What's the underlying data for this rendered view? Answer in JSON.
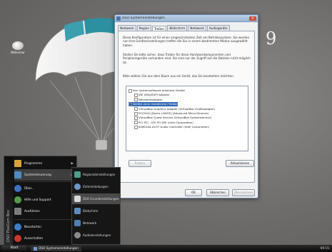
{
  "desktop": {
    "icon_label": "Mülleimer",
    "brand_numeral": "9"
  },
  "dialog": {
    "title": "DSO Systemeinstellungen",
    "tabs": [
      "Netzwerk",
      "Region",
      "Treiber",
      "Bildschirm",
      "Netzwerk",
      "Audiogeräte"
    ],
    "active_tab_index": 2,
    "intro_text": "Diese Konfiguration ist für einen eingeschränkten Zeit am Betriebssystem. Sie werden nun Ihre Geräteeinstellungen treffen die Sie in einem bestimmten Modus ausgewählt haben.",
    "hint_text": "Stellen Sie bitte sicher, dass Treiber für diese Hardwarekomponenten und Peripheriegeräte vorhanden sind. Sie sind nur der Zugriff auf die Dateien nicht möglich ist.",
    "list_caption": "Bitte wählen Sie aus dem Baum aus ein Gerät, das Sie bearbeiten möchten.",
    "tree": [
      {
        "label": "Von Systemsoftware erkannte Geräte",
        "indent": 0,
        "sel": false
      },
      {
        "label": "IDE ATA/ATAPI Adapter",
        "indent": 1,
        "sel": false
      },
      {
        "label": "Netzwerkadapter",
        "indent": 1,
        "sel": false
      },
      {
        "label": "Geräte ohne installierten Treiber",
        "indent": 0,
        "sel": true
      },
      {
        "label": "VirtualBox Graphics Adapter (VirtualBox Grafikadapter)",
        "indent": 1,
        "sel": false
      },
      {
        "label": "PCI/VGA [Dachs LANCE] (Advanced Micro Devices)",
        "indent": 1,
        "sel": false
      },
      {
        "label": "VirtualBox Guest Service (VirtualBox Systemservice)",
        "indent": 1,
        "sel": false
      },
      {
        "label": "PCI PCI - ICH PCI IDE (Intel Corporation)",
        "indent": 1,
        "sel": false
      },
      {
        "label": "82801AA AC97 Audio Controller (Intel Corporation)",
        "indent": 1,
        "sel": false
      }
    ],
    "btn_left": "Ändern",
    "btn_refresh": "Aktualisieren",
    "btn_ok": "OK",
    "btn_cancel": "Abbrechen",
    "btn_apply": "Übernehmen"
  },
  "start_menu": {
    "brand": "DSO PlusCom Box",
    "items": [
      {
        "label": "Programme",
        "arrow": true
      },
      {
        "label": "Systemsteuerung",
        "arrow": true
      },
      {
        "label": "Über...",
        "arrow": false
      },
      {
        "label": "Hilfe und Support",
        "arrow": false
      },
      {
        "label": "Ausführen",
        "arrow": false
      },
      {
        "label": "Neustarten",
        "arrow": false
      },
      {
        "label": "Ausschalten",
        "arrow": false
      }
    ],
    "highlight_index": 1
  },
  "submenu": {
    "items": [
      "Regionaleinstellungen",
      "Zeiteinstellungen",
      "DSO Grundeinstellungen",
      "Bildschirm",
      "Netzwerk",
      "Audioeinstellungen"
    ],
    "highlight_index": 2
  },
  "taskbar": {
    "start": "Start",
    "task": "DSO Systemeinstellungen",
    "clock": "09:15"
  },
  "colors": {
    "accent": "#3166b5",
    "desktop": "#6d6b69"
  }
}
